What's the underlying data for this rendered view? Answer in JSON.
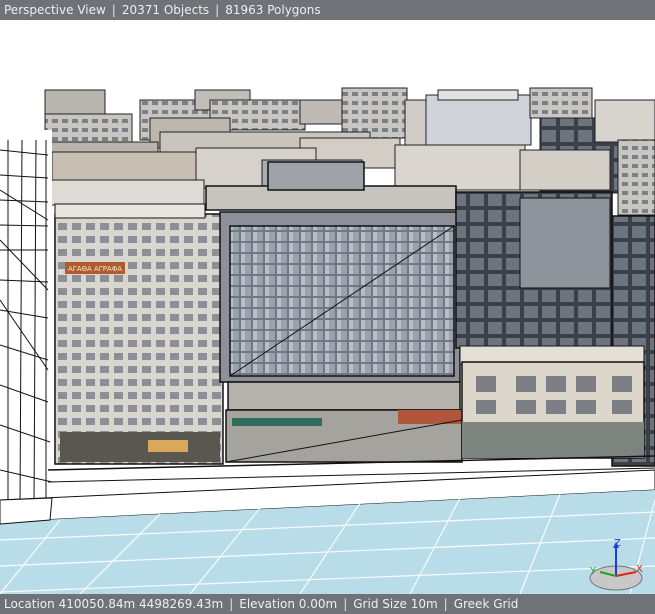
{
  "topbar": {
    "view_name": "Perspective View",
    "objects": "20371 Objects",
    "polygons": "81963 Polygons"
  },
  "statusbar": {
    "location": "Location 410050.84m 4498269.43m",
    "elevation": "Elevation 0.00m",
    "grid_size": "Grid Size 10m",
    "coordinate_system": "Greek Grid"
  },
  "axis_gizmo": {
    "z_label": "Z",
    "x_label": "X",
    "y_label": "Y",
    "colors": {
      "z": "#1a3de0",
      "x": "#e02020",
      "y": "#1aa81a"
    }
  },
  "signage": {
    "shop_sign": "ΑΓΑΘΑ ΑΓΡΑΦΑ"
  }
}
